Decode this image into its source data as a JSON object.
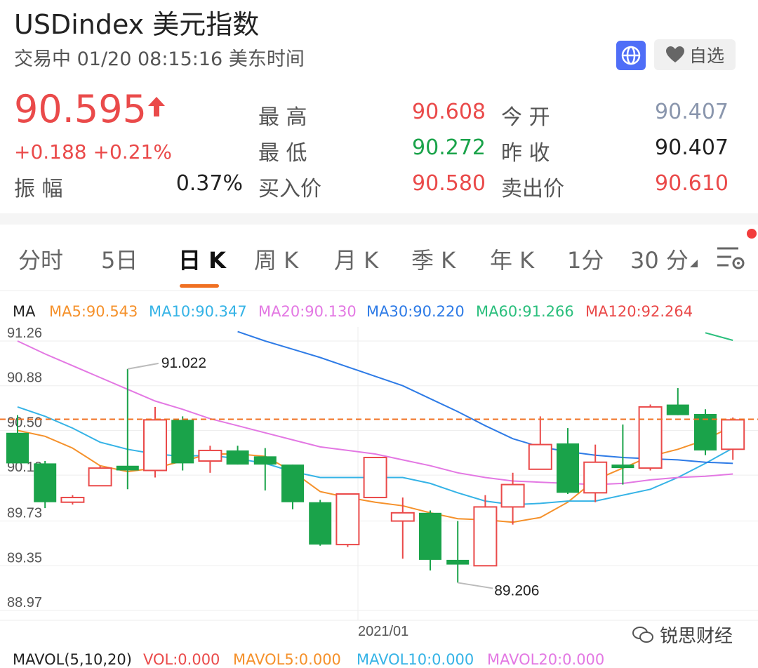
{
  "header": {
    "title": "USDindex  美元指数",
    "status": "交易中 01/20 08:15:16 美东时间",
    "fav_label": "自选"
  },
  "quote": {
    "price": "90.595",
    "change": "+0.188 +0.21%",
    "amplitude_label": "振   幅",
    "amplitude": "0.37%",
    "high_label": "最   高",
    "high": "90.608",
    "low_label": "最   低",
    "low": "90.272",
    "bid_label": "买入价",
    "bid": "90.580",
    "open_label": "今   开",
    "open": "90.407",
    "prev_label": "昨   收",
    "prev_close": "90.407",
    "ask_label": "卖出价",
    "ask": "90.610"
  },
  "tabs": [
    "分时",
    "5日",
    "日 K",
    "周 K",
    "月 K",
    "季 K",
    "年 K",
    "1分",
    "30 分"
  ],
  "active_tab": 2,
  "ma_legend": {
    "label": "MA",
    "ma5": "MA5:90.543",
    "ma10": "MA10:90.347",
    "ma20": "MA20:90.130",
    "ma30": "MA30:90.220",
    "ma60": "MA60:91.266",
    "ma120": "MA120:92.264"
  },
  "mavol_legend": {
    "label": "MAVOL(5,10,20)",
    "vol": "VOL:0.000",
    "mavol5": "MAVOL5:0.000",
    "mavol10": "MAVOL10:0.000",
    "mavol20": "MAVOL20:0.000"
  },
  "watermark": "锐思财经",
  "colors": {
    "up": "#ea4a4a",
    "down": "#1aa34a",
    "accent": "#f07022"
  },
  "chart_data": {
    "type": "candlestick",
    "ylim": [
      88.97,
      91.26
    ],
    "y_ticks": [
      "91.26",
      "90.88",
      "90.50",
      "90.12",
      "89.73",
      "89.35",
      "88.97"
    ],
    "x_label": "2021/01",
    "current_price_line": 90.595,
    "annotations": [
      {
        "label": "91.022",
        "value": 91.022,
        "candle": 4
      },
      {
        "label": "89.206",
        "value": 89.206,
        "candle": 16
      }
    ],
    "candles": [
      {
        "o": 90.48,
        "c": 90.22,
        "h": 90.63,
        "l": 90.22
      },
      {
        "o": 90.22,
        "c": 89.89,
        "h": 90.24,
        "l": 89.84
      },
      {
        "o": 89.89,
        "c": 89.93,
        "h": 89.95,
        "l": 89.87
      },
      {
        "o": 90.03,
        "c": 90.18,
        "h": 90.2,
        "l": 90.03
      },
      {
        "o": 90.2,
        "c": 90.16,
        "h": 91.022,
        "l": 90.0
      },
      {
        "o": 90.16,
        "c": 90.59,
        "h": 90.7,
        "l": 90.1
      },
      {
        "o": 90.59,
        "c": 90.22,
        "h": 90.62,
        "l": 90.16
      },
      {
        "o": 90.24,
        "c": 90.33,
        "h": 90.37,
        "l": 90.14
      },
      {
        "o": 90.33,
        "c": 90.21,
        "h": 90.37,
        "l": 90.21
      },
      {
        "o": 90.28,
        "c": 90.21,
        "h": 90.35,
        "l": 89.99
      },
      {
        "o": 90.21,
        "c": 89.89,
        "h": 90.21,
        "l": 89.83
      },
      {
        "o": 89.89,
        "c": 89.53,
        "h": 89.91,
        "l": 89.52
      },
      {
        "o": 89.53,
        "c": 89.96,
        "h": 89.96,
        "l": 89.51
      },
      {
        "o": 89.93,
        "c": 90.27,
        "h": 90.27,
        "l": 89.93
      },
      {
        "o": 89.73,
        "c": 89.8,
        "h": 89.93,
        "l": 89.41
      },
      {
        "o": 89.8,
        "c": 89.4,
        "h": 89.82,
        "l": 89.31
      },
      {
        "o": 89.4,
        "c": 89.36,
        "h": 89.73,
        "l": 89.206
      },
      {
        "o": 89.35,
        "c": 89.85,
        "h": 89.95,
        "l": 89.35
      },
      {
        "o": 89.85,
        "c": 90.04,
        "h": 90.14,
        "l": 89.7
      },
      {
        "o": 90.17,
        "c": 90.38,
        "h": 90.62,
        "l": 90.17
      },
      {
        "o": 90.39,
        "c": 89.97,
        "h": 90.52,
        "l": 89.96
      },
      {
        "o": 89.97,
        "c": 90.23,
        "h": 90.38,
        "l": 89.89
      },
      {
        "o": 90.21,
        "c": 90.18,
        "h": 90.55,
        "l": 90.04
      },
      {
        "o": 90.18,
        "c": 90.7,
        "h": 90.72,
        "l": 90.16
      },
      {
        "o": 90.72,
        "c": 90.63,
        "h": 90.86,
        "l": 90.63
      },
      {
        "o": 90.64,
        "c": 90.33,
        "h": 90.68,
        "l": 90.29
      },
      {
        "o": 90.34,
        "c": 90.59,
        "h": 90.61,
        "l": 90.25
      }
    ],
    "series": [
      {
        "name": "MA5",
        "color": "#f5912b",
        "values": [
          90.5,
          90.45,
          90.35,
          90.2,
          90.15,
          90.18,
          90.24,
          90.3,
          90.3,
          90.28,
          90.15,
          89.98,
          89.93,
          89.89,
          89.86,
          89.8,
          89.75,
          89.74,
          89.72,
          89.76,
          89.89,
          90.08,
          90.18,
          90.28,
          90.34,
          90.42,
          90.54
        ]
      },
      {
        "name": "MA10",
        "color": "#35b3e6",
        "values": [
          90.7,
          90.62,
          90.52,
          90.4,
          90.34,
          90.3,
          90.28,
          90.29,
          90.26,
          90.22,
          90.15,
          90.1,
          90.1,
          90.1,
          90.1,
          90.05,
          89.97,
          89.9,
          89.87,
          89.88,
          89.9,
          89.9,
          89.95,
          90.0,
          90.1,
          90.22,
          90.35
        ]
      },
      {
        "name": "MA20",
        "color": "#e378e3",
        "values": [
          91.26,
          91.15,
          91.05,
          90.95,
          90.85,
          90.75,
          90.68,
          90.6,
          90.54,
          90.48,
          90.42,
          90.36,
          90.33,
          90.3,
          90.25,
          90.2,
          90.14,
          90.1,
          90.07,
          90.06,
          90.05,
          90.04,
          90.05,
          90.08,
          90.1,
          90.11,
          90.13
        ]
      },
      {
        "name": "MA30",
        "color": "#2e7be6",
        "values": [
          null,
          null,
          null,
          null,
          91.62,
          91.57,
          91.5,
          91.42,
          91.34,
          91.26,
          91.19,
          91.12,
          91.04,
          90.96,
          90.88,
          90.77,
          90.66,
          90.54,
          90.43,
          90.36,
          90.32,
          90.29,
          90.27,
          90.26,
          90.25,
          90.23,
          90.22
        ]
      },
      {
        "name": "MA60",
        "color": "#2bbf7d",
        "values": [
          null,
          null,
          null,
          null,
          null,
          null,
          null,
          null,
          null,
          null,
          null,
          null,
          null,
          null,
          null,
          null,
          null,
          null,
          null,
          null,
          null,
          null,
          null,
          91.46,
          91.4,
          91.33,
          91.266
        ]
      }
    ]
  }
}
